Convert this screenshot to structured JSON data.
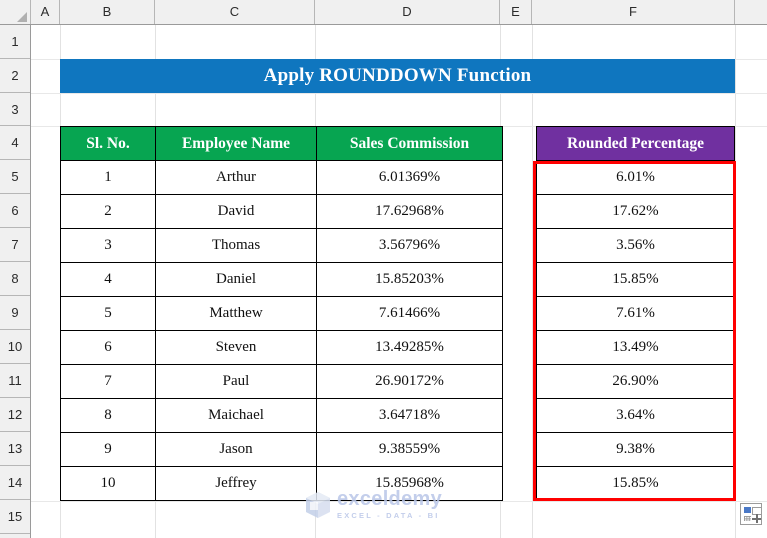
{
  "app": {
    "type": "spreadsheet",
    "column_headers": [
      "A",
      "B",
      "C",
      "D",
      "E",
      "F"
    ],
    "row_headers": [
      "1",
      "2",
      "3",
      "4",
      "5",
      "6",
      "7",
      "8",
      "9",
      "10",
      "11",
      "12",
      "13",
      "14",
      "15"
    ]
  },
  "banner": {
    "title": "Apply ROUNDDOWN Function",
    "background_color": "#0f76bf",
    "text_color": "#ffffff"
  },
  "main_table": {
    "header_color": "#07a551",
    "header_text_color": "#ffffff",
    "columns": [
      "Sl. No.",
      "Employee Name",
      "Sales Commission"
    ],
    "rows": [
      {
        "sl_no": "1",
        "employee": "Arthur",
        "commission": "6.01369%"
      },
      {
        "sl_no": "2",
        "employee": "David",
        "commission": "17.62968%"
      },
      {
        "sl_no": "3",
        "employee": "Thomas",
        "commission": "3.56796%"
      },
      {
        "sl_no": "4",
        "employee": "Daniel",
        "commission": "15.85203%"
      },
      {
        "sl_no": "5",
        "employee": "Matthew",
        "commission": "7.61466%"
      },
      {
        "sl_no": "6",
        "employee": "Steven",
        "commission": "13.49285%"
      },
      {
        "sl_no": "7",
        "employee": "Paul",
        "commission": "26.90172%"
      },
      {
        "sl_no": "8",
        "employee": "Maichael",
        "commission": "3.64718%"
      },
      {
        "sl_no": "9",
        "employee": "Jason",
        "commission": "9.38559%"
      },
      {
        "sl_no": "10",
        "employee": "Jeffrey",
        "commission": "15.85968%"
      }
    ]
  },
  "rounded_table": {
    "header_color": "#7030a0",
    "header_text_color": "#ffffff",
    "selection_border_color": "#ff0000",
    "column": "Rounded Percentage",
    "values": [
      "6.01%",
      "17.62%",
      "3.56%",
      "15.85%",
      "7.61%",
      "13.49%",
      "26.90%",
      "3.64%",
      "9.38%",
      "15.85%"
    ]
  },
  "watermark": {
    "name": "exceldemy",
    "tagline": "EXCEL - DATA - BI",
    "color": "#b9c6e8"
  },
  "quick_analysis": {
    "label": "Quick Analysis"
  }
}
